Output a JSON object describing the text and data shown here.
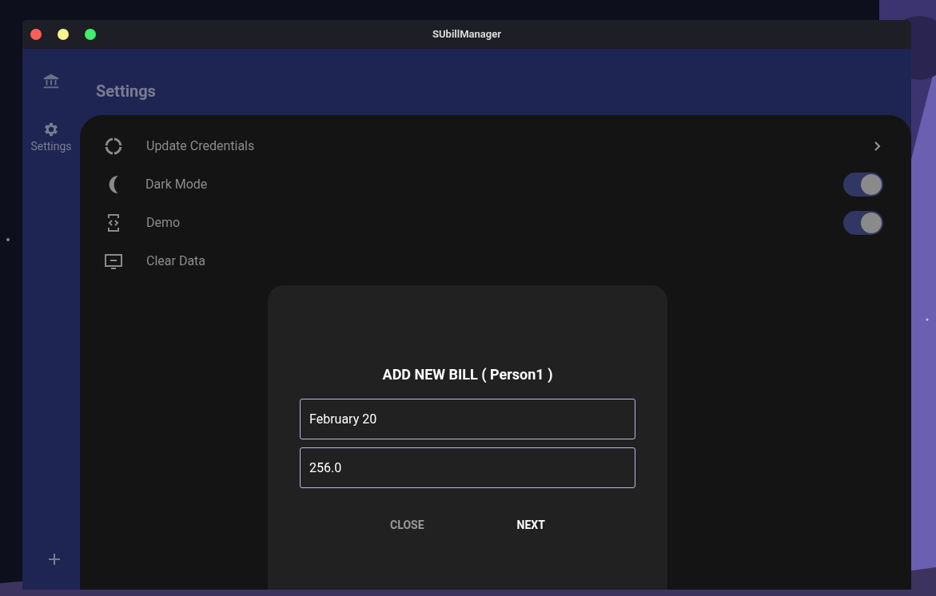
{
  "window": {
    "title": "SUbillManager"
  },
  "sidebar": {
    "items": [
      {
        "kind": "icon"
      },
      {
        "kind": "labeled",
        "label": "Settings"
      }
    ]
  },
  "header": {
    "title": "Settings"
  },
  "settings": [
    {
      "kind": "link",
      "label": "Update Credentials"
    },
    {
      "kind": "toggle",
      "label": "Dark Mode",
      "on": true
    },
    {
      "kind": "toggle",
      "label": "Demo",
      "on": true
    },
    {
      "kind": "action",
      "label": "Clear Data"
    }
  ],
  "dialog": {
    "title": "ADD NEW BILL ( Person1 )",
    "fields": [
      {
        "value": "February 20"
      },
      {
        "value": "256.0"
      }
    ],
    "buttons": [
      {
        "kind": "secondary",
        "label": "CLOSE"
      },
      {
        "kind": "primary",
        "label": "NEXT"
      }
    ]
  }
}
